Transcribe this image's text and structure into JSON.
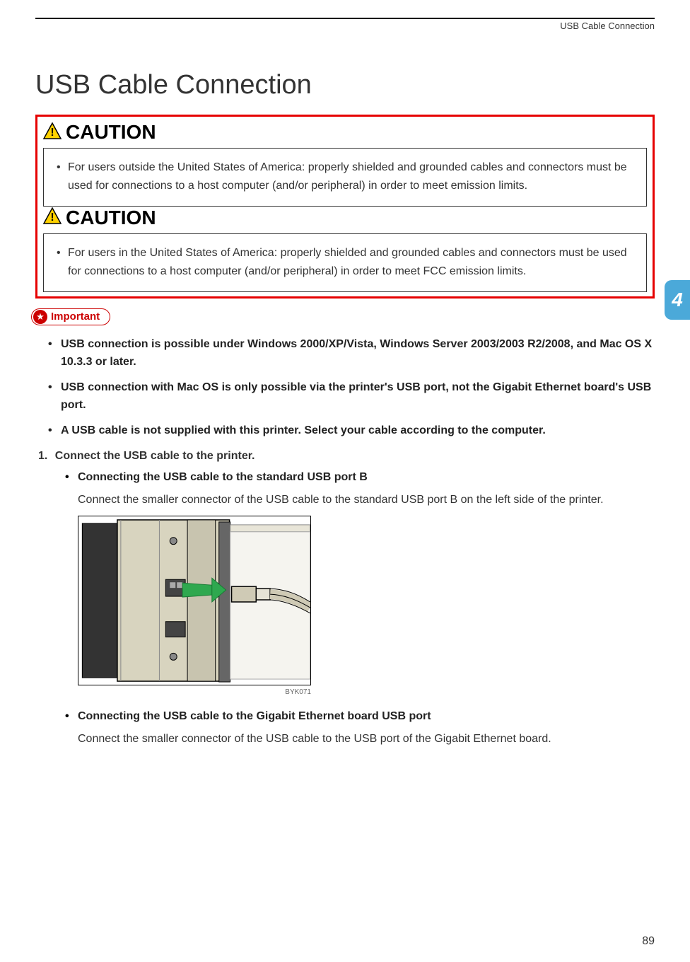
{
  "header": {
    "running_title": "USB Cable Connection"
  },
  "page_title": "USB Cable Connection",
  "caution_blocks": [
    {
      "label": "CAUTION",
      "body": "For users outside the United States of America: properly shielded and grounded cables and connectors must be used for connections to a host computer (and/or peripheral) in order to meet emission limits."
    },
    {
      "label": "CAUTION",
      "body": "For users in the United States of America: properly shielded and grounded cables and connectors must be used for connections to a host computer (and/or peripheral) in order to meet FCC emission limits."
    }
  ],
  "side_tab": "4",
  "important": {
    "label": "Important",
    "items": [
      "USB connection is possible under Windows 2000/XP/Vista, Windows Server 2003/2003 R2/2008, and Mac OS X 10.3.3 or later.",
      "USB connection with Mac OS is only possible via the printer's USB port, not the Gigabit Ethernet board's USB port.",
      "A USB cable is not supplied with this printer. Select your cable according to the computer."
    ]
  },
  "step": {
    "number": "1.",
    "text": "Connect the USB cable to the printer.",
    "subitems": [
      {
        "heading": "Connecting the USB cable to the standard USB port B",
        "desc": "Connect the smaller connector of the USB cable to the standard USB port B on the left side of the printer.",
        "figure_code": "BYK071"
      },
      {
        "heading": "Connecting the USB cable to the Gigabit Ethernet board USB port",
        "desc": "Connect the smaller connector of the USB cable to the USB port of the Gigabit Ethernet board."
      }
    ]
  },
  "page_number": "89"
}
